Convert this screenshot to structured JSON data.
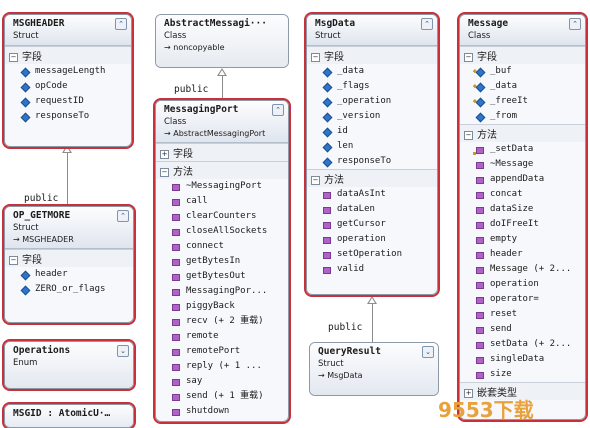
{
  "msgheader": {
    "title": "MSGHEADER",
    "kind": "Struct",
    "fields_label": "字段",
    "fields": [
      "messageLength",
      "opCode",
      "requestID",
      "responseTo"
    ]
  },
  "abstract": {
    "title": "AbstractMessagi···",
    "kind": "Class",
    "base": "noncopyable"
  },
  "msgdata": {
    "title": "MsgData",
    "kind": "Struct",
    "fields_label": "字段",
    "fields": [
      "_data",
      "_flags",
      "_operation",
      "_version",
      "id",
      "len",
      "responseTo"
    ],
    "methods_label": "方法",
    "methods": [
      "dataAsInt",
      "dataLen",
      "getCursor",
      "operation",
      "setOperation",
      "valid"
    ]
  },
  "message": {
    "title": "Message",
    "kind": "Class",
    "fields_label": "字段",
    "fields": [
      "_buf",
      "_data",
      "_freeIt",
      "_from"
    ],
    "methods_label": "方法",
    "methods": [
      "_setData",
      "~Message",
      "appendData",
      "concat",
      "dataSize",
      "doIFreeIt",
      "empty",
      "header",
      "Message (+ 2...",
      "operation",
      "operator=",
      "reset",
      "send",
      "setData (+ 2...",
      "singleData",
      "size"
    ],
    "nested_label": "嵌套类型"
  },
  "messagingport": {
    "title": "MessagingPort",
    "kind": "Class",
    "base": "AbstractMessagingPort",
    "fields_label": "字段",
    "methods_label": "方法",
    "methods": [
      "~MessagingPort",
      "call",
      "clearCounters",
      "closeAllSockets",
      "connect",
      "getBytesIn",
      "getBytesOut",
      "MessagingPor...",
      "piggyBack",
      "recv (+ 2 重载)",
      "remote",
      "remotePort",
      "reply (+ 1 ...",
      "say",
      "send (+ 1 重载)",
      "shutdown"
    ]
  },
  "opgetmore": {
    "title": "OP_GETMORE",
    "kind": "Struct",
    "base": "MSGHEADER",
    "fields_label": "字段",
    "fields": [
      "header",
      "ZERO_or_flags"
    ]
  },
  "operations": {
    "title": "Operations",
    "kind": "Enum"
  },
  "msgid": {
    "title": "MSGID : AtomicU···"
  },
  "queryresult": {
    "title": "QueryResult",
    "kind": "Struct",
    "base": "MsgData"
  },
  "labels": {
    "public1": "public",
    "public2": "public",
    "public3": "public"
  },
  "watermark": {
    "text": "9553下载"
  }
}
